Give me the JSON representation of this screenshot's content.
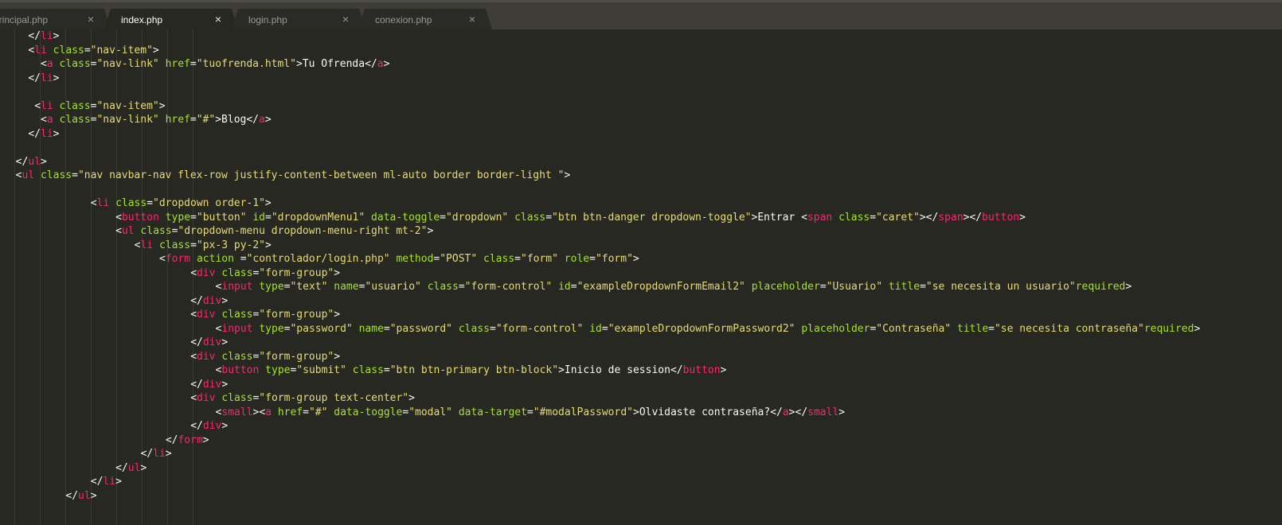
{
  "tabs": [
    {
      "label": "principal.php",
      "close": "×",
      "active": false
    },
    {
      "label": "index.php",
      "close": "×",
      "active": true
    },
    {
      "label": "login.php",
      "close": "×",
      "active": false
    },
    {
      "label": "conexion.php",
      "close": "×",
      "active": false
    }
  ],
  "colors": {
    "background": "#272822",
    "tag": "#f92672",
    "attribute": "#a6e22e",
    "string": "#e6db74",
    "text": "#f8f8f2"
  },
  "code_lines": [
    {
      "indent": 4,
      "tokens": [
        [
          "p",
          "</"
        ],
        [
          "t",
          "li"
        ],
        [
          "p",
          ">"
        ]
      ]
    },
    {
      "indent": 4,
      "tokens": [
        [
          "p",
          "<"
        ],
        [
          "t",
          "li"
        ],
        [
          "p",
          " "
        ],
        [
          "a",
          "class"
        ],
        [
          "p",
          "="
        ],
        [
          "s",
          "\"nav-item\""
        ],
        [
          "p",
          ">"
        ]
      ]
    },
    {
      "indent": 6,
      "tokens": [
        [
          "p",
          "<"
        ],
        [
          "t",
          "a"
        ],
        [
          "p",
          " "
        ],
        [
          "a",
          "class"
        ],
        [
          "p",
          "="
        ],
        [
          "s",
          "\"nav-link\""
        ],
        [
          "p",
          " "
        ],
        [
          "a",
          "href"
        ],
        [
          "p",
          "="
        ],
        [
          "s",
          "\"tuofrenda.html\""
        ],
        [
          "p",
          ">"
        ],
        [
          "x",
          "Tu Ofrenda"
        ],
        [
          "p",
          "</"
        ],
        [
          "t",
          "a"
        ],
        [
          "p",
          ">"
        ]
      ]
    },
    {
      "indent": 4,
      "tokens": [
        [
          "p",
          "</"
        ],
        [
          "t",
          "li"
        ],
        [
          "p",
          ">"
        ]
      ]
    },
    {
      "indent": 0,
      "tokens": []
    },
    {
      "indent": 5,
      "tokens": [
        [
          "p",
          "<"
        ],
        [
          "t",
          "li"
        ],
        [
          "p",
          " "
        ],
        [
          "a",
          "class"
        ],
        [
          "p",
          "="
        ],
        [
          "s",
          "\"nav-item\""
        ],
        [
          "p",
          ">"
        ]
      ]
    },
    {
      "indent": 6,
      "tokens": [
        [
          "p",
          "<"
        ],
        [
          "t",
          "a"
        ],
        [
          "p",
          " "
        ],
        [
          "a",
          "class"
        ],
        [
          "p",
          "="
        ],
        [
          "s",
          "\"nav-link\""
        ],
        [
          "p",
          " "
        ],
        [
          "a",
          "href"
        ],
        [
          "p",
          "="
        ],
        [
          "s",
          "\"#\""
        ],
        [
          "p",
          ">"
        ],
        [
          "x",
          "Blog"
        ],
        [
          "p",
          "</"
        ],
        [
          "t",
          "a"
        ],
        [
          "p",
          ">"
        ]
      ]
    },
    {
      "indent": 4,
      "tokens": [
        [
          "p",
          "</"
        ],
        [
          "t",
          "li"
        ],
        [
          "p",
          ">"
        ]
      ]
    },
    {
      "indent": 0,
      "tokens": []
    },
    {
      "indent": 2,
      "tokens": [
        [
          "p",
          "</"
        ],
        [
          "t",
          "ul"
        ],
        [
          "p",
          ">"
        ]
      ]
    },
    {
      "indent": 2,
      "tokens": [
        [
          "p",
          "<"
        ],
        [
          "t",
          "ul"
        ],
        [
          "p",
          " "
        ],
        [
          "a",
          "class"
        ],
        [
          "p",
          "="
        ],
        [
          "s",
          "\"nav navbar-nav flex-row justify-content-between ml-auto border border-light \""
        ],
        [
          "p",
          ">"
        ]
      ]
    },
    {
      "indent": 0,
      "tokens": []
    },
    {
      "indent": 14,
      "tokens": [
        [
          "p",
          "<"
        ],
        [
          "t",
          "li"
        ],
        [
          "p",
          " "
        ],
        [
          "a",
          "class"
        ],
        [
          "p",
          "="
        ],
        [
          "s",
          "\"dropdown order-1\""
        ],
        [
          "p",
          ">"
        ]
      ]
    },
    {
      "indent": 18,
      "tokens": [
        [
          "p",
          "<"
        ],
        [
          "t",
          "button"
        ],
        [
          "p",
          " "
        ],
        [
          "a",
          "type"
        ],
        [
          "p",
          "="
        ],
        [
          "s",
          "\"button\""
        ],
        [
          "p",
          " "
        ],
        [
          "a",
          "id"
        ],
        [
          "p",
          "="
        ],
        [
          "s",
          "\"dropdownMenu1\""
        ],
        [
          "p",
          " "
        ],
        [
          "a",
          "data-toggle"
        ],
        [
          "p",
          "="
        ],
        [
          "s",
          "\"dropdown\""
        ],
        [
          "p",
          " "
        ],
        [
          "a",
          "class"
        ],
        [
          "p",
          "="
        ],
        [
          "s",
          "\"btn btn-danger dropdown-toggle\""
        ],
        [
          "p",
          ">"
        ],
        [
          "x",
          "Entrar "
        ],
        [
          "p",
          "<"
        ],
        [
          "t",
          "span"
        ],
        [
          "p",
          " "
        ],
        [
          "a",
          "class"
        ],
        [
          "p",
          "="
        ],
        [
          "s",
          "\"caret\""
        ],
        [
          "p",
          "></"
        ],
        [
          "t",
          "span"
        ],
        [
          "p",
          "></"
        ],
        [
          "t",
          "button"
        ],
        [
          "p",
          ">"
        ]
      ]
    },
    {
      "indent": 18,
      "tokens": [
        [
          "p",
          "<"
        ],
        [
          "t",
          "ul"
        ],
        [
          "p",
          " "
        ],
        [
          "a",
          "class"
        ],
        [
          "p",
          "="
        ],
        [
          "s",
          "\"dropdown-menu dropdown-menu-right mt-2\""
        ],
        [
          "p",
          ">"
        ]
      ]
    },
    {
      "indent": 21,
      "tokens": [
        [
          "p",
          "<"
        ],
        [
          "t",
          "li"
        ],
        [
          "p",
          " "
        ],
        [
          "a",
          "class"
        ],
        [
          "p",
          "="
        ],
        [
          "s",
          "\"px-3 py-2\""
        ],
        [
          "p",
          ">"
        ]
      ]
    },
    {
      "indent": 25,
      "tokens": [
        [
          "p",
          "<"
        ],
        [
          "t",
          "form"
        ],
        [
          "p",
          " "
        ],
        [
          "a",
          "action"
        ],
        [
          "p",
          " ="
        ],
        [
          "s",
          "\"controlador/login.php\""
        ],
        [
          "p",
          " "
        ],
        [
          "a",
          "method"
        ],
        [
          "p",
          "="
        ],
        [
          "s",
          "\"POST\""
        ],
        [
          "p",
          " "
        ],
        [
          "a",
          "class"
        ],
        [
          "p",
          "="
        ],
        [
          "s",
          "\"form\""
        ],
        [
          "p",
          " "
        ],
        [
          "a",
          "role"
        ],
        [
          "p",
          "="
        ],
        [
          "s",
          "\"form\""
        ],
        [
          "p",
          ">"
        ]
      ]
    },
    {
      "indent": 30,
      "tokens": [
        [
          "p",
          "<"
        ],
        [
          "t",
          "div"
        ],
        [
          "p",
          " "
        ],
        [
          "a",
          "class"
        ],
        [
          "p",
          "="
        ],
        [
          "s",
          "\"form-group\""
        ],
        [
          "p",
          ">"
        ]
      ]
    },
    {
      "indent": 34,
      "tokens": [
        [
          "p",
          "<"
        ],
        [
          "t",
          "input"
        ],
        [
          "p",
          " "
        ],
        [
          "a",
          "type"
        ],
        [
          "p",
          "="
        ],
        [
          "s",
          "\"text\""
        ],
        [
          "p",
          " "
        ],
        [
          "a",
          "name"
        ],
        [
          "p",
          "="
        ],
        [
          "s",
          "\"usuario\""
        ],
        [
          "p",
          " "
        ],
        [
          "a",
          "class"
        ],
        [
          "p",
          "="
        ],
        [
          "s",
          "\"form-control\""
        ],
        [
          "p",
          " "
        ],
        [
          "a",
          "id"
        ],
        [
          "p",
          "="
        ],
        [
          "s",
          "\"exampleDropdownFormEmail2\""
        ],
        [
          "p",
          " "
        ],
        [
          "a",
          "placeholder"
        ],
        [
          "p",
          "="
        ],
        [
          "s",
          "\"Usuario\""
        ],
        [
          "p",
          " "
        ],
        [
          "a",
          "title"
        ],
        [
          "p",
          "="
        ],
        [
          "s",
          "\"se necesita un usuario\""
        ],
        [
          "a",
          "required"
        ],
        [
          "p",
          ">"
        ]
      ]
    },
    {
      "indent": 30,
      "tokens": [
        [
          "p",
          "</"
        ],
        [
          "t",
          "div"
        ],
        [
          "p",
          ">"
        ]
      ]
    },
    {
      "indent": 30,
      "tokens": [
        [
          "p",
          "<"
        ],
        [
          "t",
          "div"
        ],
        [
          "p",
          " "
        ],
        [
          "a",
          "class"
        ],
        [
          "p",
          "="
        ],
        [
          "s",
          "\"form-group\""
        ],
        [
          "p",
          ">"
        ]
      ]
    },
    {
      "indent": 34,
      "tokens": [
        [
          "p",
          "<"
        ],
        [
          "t",
          "input"
        ],
        [
          "p",
          " "
        ],
        [
          "a",
          "type"
        ],
        [
          "p",
          "="
        ],
        [
          "s",
          "\"password\""
        ],
        [
          "p",
          " "
        ],
        [
          "a",
          "name"
        ],
        [
          "p",
          "="
        ],
        [
          "s",
          "\"password\""
        ],
        [
          "p",
          " "
        ],
        [
          "a",
          "class"
        ],
        [
          "p",
          "="
        ],
        [
          "s",
          "\"form-control\""
        ],
        [
          "p",
          " "
        ],
        [
          "a",
          "id"
        ],
        [
          "p",
          "="
        ],
        [
          "s",
          "\"exampleDropdownFormPassword2\""
        ],
        [
          "p",
          " "
        ],
        [
          "a",
          "placeholder"
        ],
        [
          "p",
          "="
        ],
        [
          "s",
          "\"Contraseña\""
        ],
        [
          "p",
          " "
        ],
        [
          "a",
          "title"
        ],
        [
          "p",
          "="
        ],
        [
          "s",
          "\"se necesita contraseña\""
        ],
        [
          "a",
          "required"
        ],
        [
          "p",
          ">"
        ]
      ]
    },
    {
      "indent": 30,
      "tokens": [
        [
          "p",
          "</"
        ],
        [
          "t",
          "div"
        ],
        [
          "p",
          ">"
        ]
      ]
    },
    {
      "indent": 30,
      "tokens": [
        [
          "p",
          "<"
        ],
        [
          "t",
          "div"
        ],
        [
          "p",
          " "
        ],
        [
          "a",
          "class"
        ],
        [
          "p",
          "="
        ],
        [
          "s",
          "\"form-group\""
        ],
        [
          "p",
          ">"
        ]
      ]
    },
    {
      "indent": 34,
      "tokens": [
        [
          "p",
          "<"
        ],
        [
          "t",
          "button"
        ],
        [
          "p",
          " "
        ],
        [
          "a",
          "type"
        ],
        [
          "p",
          "="
        ],
        [
          "s",
          "\"submit\""
        ],
        [
          "p",
          " "
        ],
        [
          "a",
          "class"
        ],
        [
          "p",
          "="
        ],
        [
          "s",
          "\"btn btn-primary btn-block\""
        ],
        [
          "p",
          ">"
        ],
        [
          "x",
          "Inicio de session"
        ],
        [
          "p",
          "</"
        ],
        [
          "t",
          "button"
        ],
        [
          "p",
          ">"
        ]
      ]
    },
    {
      "indent": 30,
      "tokens": [
        [
          "p",
          "</"
        ],
        [
          "t",
          "div"
        ],
        [
          "p",
          ">"
        ]
      ]
    },
    {
      "indent": 30,
      "tokens": [
        [
          "p",
          "<"
        ],
        [
          "t",
          "div"
        ],
        [
          "p",
          " "
        ],
        [
          "a",
          "class"
        ],
        [
          "p",
          "="
        ],
        [
          "s",
          "\"form-group text-center\""
        ],
        [
          "p",
          ">"
        ]
      ]
    },
    {
      "indent": 34,
      "tokens": [
        [
          "p",
          "<"
        ],
        [
          "t",
          "small"
        ],
        [
          "p",
          "><"
        ],
        [
          "t",
          "a"
        ],
        [
          "p",
          " "
        ],
        [
          "a",
          "href"
        ],
        [
          "p",
          "="
        ],
        [
          "s",
          "\"#\""
        ],
        [
          "p",
          " "
        ],
        [
          "a",
          "data-toggle"
        ],
        [
          "p",
          "="
        ],
        [
          "s",
          "\"modal\""
        ],
        [
          "p",
          " "
        ],
        [
          "a",
          "data-target"
        ],
        [
          "p",
          "="
        ],
        [
          "s",
          "\"#modalPassword\""
        ],
        [
          "p",
          ">"
        ],
        [
          "x",
          "Olvidaste contraseña?"
        ],
        [
          "p",
          "</"
        ],
        [
          "t",
          "a"
        ],
        [
          "p",
          "></"
        ],
        [
          "t",
          "small"
        ],
        [
          "p",
          ">"
        ]
      ]
    },
    {
      "indent": 30,
      "tokens": [
        [
          "p",
          "</"
        ],
        [
          "t",
          "div"
        ],
        [
          "p",
          ">"
        ]
      ]
    },
    {
      "indent": 26,
      "tokens": [
        [
          "p",
          "</"
        ],
        [
          "t",
          "form"
        ],
        [
          "p",
          ">"
        ]
      ]
    },
    {
      "indent": 22,
      "tokens": [
        [
          "p",
          "</"
        ],
        [
          "t",
          "li"
        ],
        [
          "p",
          ">"
        ]
      ]
    },
    {
      "indent": 18,
      "tokens": [
        [
          "p",
          "</"
        ],
        [
          "t",
          "ul"
        ],
        [
          "p",
          ">"
        ]
      ]
    },
    {
      "indent": 14,
      "tokens": [
        [
          "p",
          "</"
        ],
        [
          "t",
          "li"
        ],
        [
          "p",
          ">"
        ]
      ]
    },
    {
      "indent": 10,
      "tokens": [
        [
          "p",
          "</"
        ],
        [
          "t",
          "ul"
        ],
        [
          "p",
          ">"
        ]
      ]
    }
  ]
}
